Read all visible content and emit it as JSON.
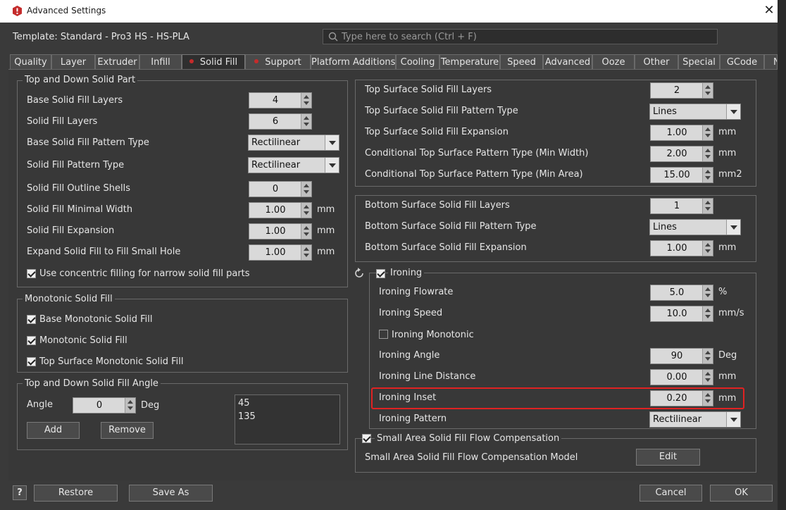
{
  "window": {
    "title": "Advanced Settings",
    "close_glyph": "✕"
  },
  "template": {
    "label": "Template: Standard - Pro3 HS - HS-PLA"
  },
  "search": {
    "placeholder": "Type here to search (Ctrl + F)"
  },
  "tabs": [
    {
      "label": "Quality"
    },
    {
      "label": "Layer"
    },
    {
      "label": "Extruder"
    },
    {
      "label": "Infill"
    },
    {
      "label": "Solid Fill",
      "active": true,
      "modified": true
    },
    {
      "label": "Support",
      "modified": true
    },
    {
      "label": "Platform Additions"
    },
    {
      "label": "Cooling"
    },
    {
      "label": "Temperature"
    },
    {
      "label": "Speed"
    },
    {
      "label": "Advanced"
    },
    {
      "label": "Ooze"
    },
    {
      "label": "Other"
    },
    {
      "label": "Special"
    },
    {
      "label": "GCode"
    },
    {
      "label": "N"
    }
  ],
  "top_down": {
    "title": "Top and Down Solid Part",
    "base_layers": {
      "label": "Base Solid Fill Layers",
      "value": "4"
    },
    "layers": {
      "label": "Solid Fill Layers",
      "value": "6"
    },
    "base_pattern": {
      "label": "Base Solid Fill Pattern Type",
      "value": "Rectilinear"
    },
    "pattern": {
      "label": "Solid Fill Pattern Type",
      "value": "Rectilinear"
    },
    "outline": {
      "label": "Solid Fill Outline Shells",
      "value": "0"
    },
    "min_width": {
      "label": "Solid Fill Minimal Width",
      "value": "1.00",
      "unit": "mm"
    },
    "expansion": {
      "label": "Solid Fill Expansion",
      "value": "1.00",
      "unit": "mm"
    },
    "expand_hole": {
      "label": "Expand Solid Fill to Fill Small Hole",
      "value": "1.00",
      "unit": "mm"
    },
    "concentric": {
      "label": "Use concentric filling for narrow solid fill parts",
      "checked": true
    }
  },
  "monotonic": {
    "title": "Monotonic Solid Fill",
    "base": {
      "label": "Base Monotonic Solid Fill",
      "checked": true
    },
    "fill": {
      "label": "Monotonic Solid Fill",
      "checked": true
    },
    "top": {
      "label": "Top Surface Monotonic Solid Fill",
      "checked": true
    }
  },
  "angle": {
    "title": "Top and Down Solid Fill Angle",
    "label": "Angle",
    "value": "0",
    "unit": "Deg",
    "list": [
      "45",
      "135"
    ],
    "add": "Add",
    "remove": "Remove"
  },
  "top_surface": {
    "layers": {
      "label": "Top Surface Solid Fill Layers",
      "value": "2"
    },
    "pattern": {
      "label": "Top Surface Solid Fill Pattern Type",
      "value": "Lines"
    },
    "expansion": {
      "label": "Top Surface Solid Fill Expansion",
      "value": "1.00",
      "unit": "mm"
    },
    "cond_width": {
      "label": "Conditional Top Surface Pattern Type (Min Width)",
      "value": "2.00",
      "unit": "mm"
    },
    "cond_area": {
      "label": "Conditional Top Surface Pattern Type (Min Area)",
      "value": "15.00",
      "unit": "mm2"
    }
  },
  "bottom_surface": {
    "layers": {
      "label": "Bottom Surface Solid Fill Layers",
      "value": "1"
    },
    "pattern": {
      "label": "Bottom Surface Solid Fill Pattern Type",
      "value": "Lines"
    },
    "expansion": {
      "label": "Bottom Surface Solid Fill Expansion",
      "value": "1.00",
      "unit": "mm"
    }
  },
  "ironing": {
    "title": "Ironing",
    "checked": true,
    "flowrate": {
      "label": "Ironing Flowrate",
      "value": "5.0",
      "unit": "%"
    },
    "speed": {
      "label": "Ironing Speed",
      "value": "10.0",
      "unit": "mm/s"
    },
    "monotonic": {
      "label": "Ironing Monotonic",
      "checked": false
    },
    "angle": {
      "label": "Ironing Angle",
      "value": "90",
      "unit": "Deg"
    },
    "line_distance": {
      "label": "Ironing Line Distance",
      "value": "0.00",
      "unit": "mm"
    },
    "inset": {
      "label": "Ironing Inset",
      "value": "0.20",
      "unit": "mm"
    },
    "pattern": {
      "label": "Ironing Pattern",
      "value": "Rectilinear"
    }
  },
  "small_area": {
    "title": "Small Area Solid Fill Flow Compensation",
    "checked": true,
    "model_label": "Small Area Solid Fill Flow Compensation Model",
    "edit": "Edit"
  },
  "footer": {
    "help": "?",
    "restore": "Restore",
    "save_as": "Save As",
    "cancel": "Cancel",
    "ok": "OK"
  },
  "colors": {
    "highlight": "#e02222",
    "modified_dot": "#c52b2b"
  }
}
